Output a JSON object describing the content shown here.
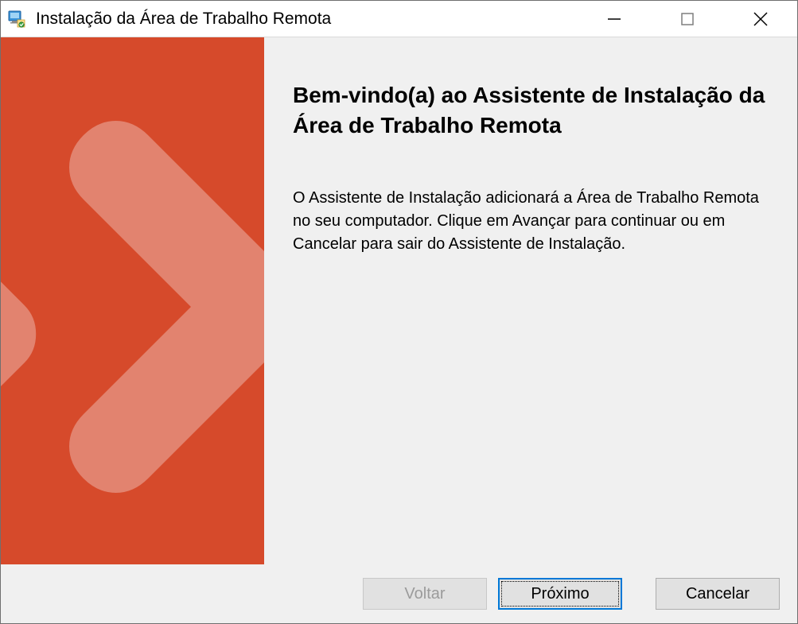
{
  "window": {
    "title": "Instalação da Área de Trabalho Remota"
  },
  "main": {
    "heading": "Bem-vindo(a) ao Assistente de Instalação da Área de Trabalho Remota",
    "body": "O Assistente de Instalação adicionará a Área de Trabalho Remota no seu computador. Clique em Avançar para continuar ou em Cancelar para sair do Assistente de Instalação."
  },
  "buttons": {
    "back": "Voltar",
    "next": "Próximo",
    "cancel": "Cancelar"
  },
  "colors": {
    "accent": "#d64a2b",
    "accent_light": "#e2836f"
  }
}
